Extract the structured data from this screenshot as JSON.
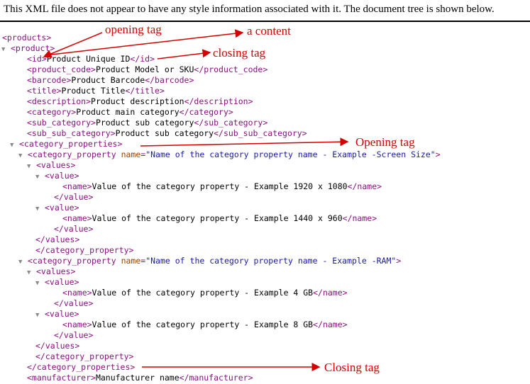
{
  "header_message": "This XML file does not appear to have any style information associated with it. The document tree is shown below.",
  "toggle_glyph": "▼",
  "accent_colors": {
    "tag": "#881280",
    "attr_name": "#994500",
    "attr_value": "#1a1aa6",
    "annotation": "#d40000"
  },
  "tree_lines": [
    {
      "toggle": true,
      "parts": [
        {
          "t": "tg",
          "v": "<products>"
        }
      ]
    },
    {
      "toggle": true,
      "parts": [
        {
          "t": "tg",
          "v": "<product>"
        }
      ]
    },
    {
      "toggle": false,
      "parts": [
        {
          "t": "tg",
          "v": "<id>"
        },
        {
          "t": "tx",
          "v": "Product Unique ID"
        },
        {
          "t": "tg",
          "v": "</id>"
        }
      ]
    },
    {
      "toggle": false,
      "parts": [
        {
          "t": "tg",
          "v": "<product_code>"
        },
        {
          "t": "tx",
          "v": "Product Model or SKU"
        },
        {
          "t": "tg",
          "v": "</product_code>"
        }
      ]
    },
    {
      "toggle": false,
      "parts": [
        {
          "t": "tg",
          "v": "<barcode>"
        },
        {
          "t": "tx",
          "v": "Product Barcode"
        },
        {
          "t": "tg",
          "v": "</barcode>"
        }
      ]
    },
    {
      "toggle": false,
      "parts": [
        {
          "t": "tg",
          "v": "<title>"
        },
        {
          "t": "tx",
          "v": "Product Title"
        },
        {
          "t": "tg",
          "v": "</title>"
        }
      ]
    },
    {
      "toggle": false,
      "parts": [
        {
          "t": "tg",
          "v": "<description>"
        },
        {
          "t": "tx",
          "v": "Product description"
        },
        {
          "t": "tg",
          "v": "</description>"
        }
      ]
    },
    {
      "toggle": false,
      "parts": [
        {
          "t": "tg",
          "v": "<category>"
        },
        {
          "t": "tx",
          "v": "Product main category"
        },
        {
          "t": "tg",
          "v": "</category>"
        }
      ]
    },
    {
      "toggle": false,
      "parts": [
        {
          "t": "tg",
          "v": "<sub_category>"
        },
        {
          "t": "tx",
          "v": "Product sub category"
        },
        {
          "t": "tg",
          "v": "</sub_category>"
        }
      ]
    },
    {
      "toggle": false,
      "parts": [
        {
          "t": "tg",
          "v": "<sub_sub_category>"
        },
        {
          "t": "tx",
          "v": "Product sub category"
        },
        {
          "t": "tg",
          "v": "</sub_sub_category>"
        }
      ]
    },
    {
      "toggle": true,
      "parts": [
        {
          "t": "tg",
          "v": "<category_properties>"
        }
      ]
    },
    {
      "toggle": true,
      "parts": [
        {
          "t": "tg",
          "v": "<category_property "
        },
        {
          "t": "an",
          "v": "name"
        },
        {
          "t": "tg",
          "v": "="
        },
        {
          "t": "av",
          "v": "\"Name of the category property name - Example -Screen Size\""
        },
        {
          "t": "tg",
          "v": ">"
        }
      ]
    },
    {
      "toggle": true,
      "parts": [
        {
          "t": "tg",
          "v": "<values>"
        }
      ]
    },
    {
      "toggle": true,
      "parts": [
        {
          "t": "tg",
          "v": "<value>"
        }
      ]
    },
    {
      "toggle": false,
      "parts": [
        {
          "t": "tg",
          "v": "<name>"
        },
        {
          "t": "tx",
          "v": "Value of the category property - Example 1920 x 1080"
        },
        {
          "t": "tg",
          "v": "</name>"
        }
      ]
    },
    {
      "toggle": false,
      "parts": [
        {
          "t": "tg",
          "v": "</value>"
        }
      ]
    },
    {
      "toggle": true,
      "parts": [
        {
          "t": "tg",
          "v": "<value>"
        }
      ]
    },
    {
      "toggle": false,
      "parts": [
        {
          "t": "tg",
          "v": "<name>"
        },
        {
          "t": "tx",
          "v": "Value of the category property - Example 1440 x 960"
        },
        {
          "t": "tg",
          "v": "</name>"
        }
      ]
    },
    {
      "toggle": false,
      "parts": [
        {
          "t": "tg",
          "v": "</value>"
        }
      ]
    },
    {
      "toggle": false,
      "parts": [
        {
          "t": "tg",
          "v": "</values>"
        }
      ]
    },
    {
      "toggle": false,
      "parts": [
        {
          "t": "tg",
          "v": "</category_property>"
        }
      ]
    },
    {
      "toggle": true,
      "parts": [
        {
          "t": "tg",
          "v": "<category_property "
        },
        {
          "t": "an",
          "v": "name"
        },
        {
          "t": "tg",
          "v": "="
        },
        {
          "t": "av",
          "v": "\"Name of the category property name - Example -RAM\""
        },
        {
          "t": "tg",
          "v": ">"
        }
      ]
    },
    {
      "toggle": true,
      "parts": [
        {
          "t": "tg",
          "v": "<values>"
        }
      ]
    },
    {
      "toggle": true,
      "parts": [
        {
          "t": "tg",
          "v": "<value>"
        }
      ]
    },
    {
      "toggle": false,
      "parts": [
        {
          "t": "tg",
          "v": "<name>"
        },
        {
          "t": "tx",
          "v": "Value of the category property - Example 4 GB"
        },
        {
          "t": "tg",
          "v": "</name>"
        }
      ]
    },
    {
      "toggle": false,
      "parts": [
        {
          "t": "tg",
          "v": "</value>"
        }
      ]
    },
    {
      "toggle": true,
      "parts": [
        {
          "t": "tg",
          "v": "<value>"
        }
      ]
    },
    {
      "toggle": false,
      "parts": [
        {
          "t": "tg",
          "v": "<name>"
        },
        {
          "t": "tx",
          "v": "Value of the category property - Example 8 GB"
        },
        {
          "t": "tg",
          "v": "</name>"
        }
      ]
    },
    {
      "toggle": false,
      "parts": [
        {
          "t": "tg",
          "v": "</value>"
        }
      ]
    },
    {
      "toggle": false,
      "parts": [
        {
          "t": "tg",
          "v": "</values>"
        }
      ]
    },
    {
      "toggle": false,
      "parts": [
        {
          "t": "tg",
          "v": "</category_property>"
        }
      ]
    },
    {
      "toggle": false,
      "parts": [
        {
          "t": "tg",
          "v": "</category_properties>"
        }
      ]
    },
    {
      "toggle": false,
      "parts": [
        {
          "t": "tg",
          "v": "<manufacturer>"
        },
        {
          "t": "tx",
          "v": "Manufacturer name"
        },
        {
          "t": "tg",
          "v": "</manufacturer>"
        }
      ]
    }
  ],
  "annotations": {
    "opening_tag": "opening tag",
    "a_content": "a content",
    "closing_tag": "closing tag",
    "opening_tag_2": "Opening tag",
    "closing_tag_2": "Closing tag"
  }
}
